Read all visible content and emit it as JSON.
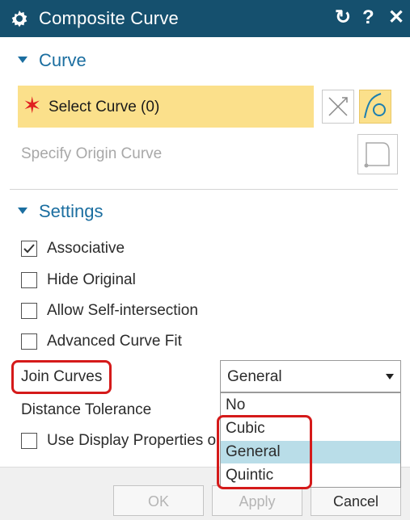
{
  "window": {
    "title": "Composite Curve",
    "reset_symbol": "↻",
    "help_symbol": "?",
    "close_symbol": "✕"
  },
  "curve_section": {
    "header": "Curve",
    "select_star": "✶",
    "select_label": "Select Curve (0)",
    "origin_label": "Specify Origin Curve"
  },
  "settings_section": {
    "header": "Settings",
    "checkboxes": [
      {
        "label": "Associative",
        "checked": true
      },
      {
        "label": "Hide Original",
        "checked": false
      },
      {
        "label": "Allow Self-intersection",
        "checked": false
      },
      {
        "label": "Advanced Curve Fit",
        "checked": false
      }
    ],
    "join_curves_label": "Join Curves",
    "join_curves_value": "General",
    "distance_tolerance_label": "Distance Tolerance",
    "use_display_label": "Use Display Properties o",
    "use_display_checked": false,
    "dropdown_options": [
      "No",
      "Cubic",
      "General",
      "Quintic"
    ],
    "dropdown_selected": "General"
  },
  "footer": {
    "ok_label": "OK",
    "apply_label": "Apply",
    "cancel_label": "Cancel"
  },
  "colors": {
    "titlebar": "#15506e",
    "accent": "#1b6ea0",
    "highlight": "#fbe08b",
    "annotation_red": "#d51a1a",
    "selected_option": "#b9dde8"
  }
}
